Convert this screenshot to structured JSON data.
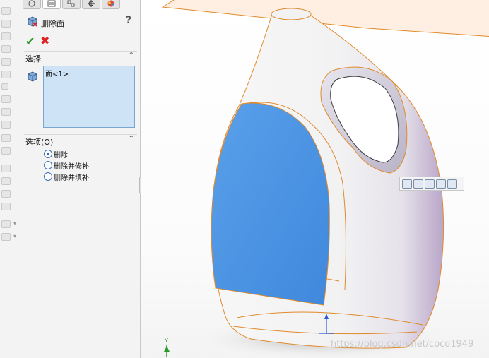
{
  "feature_manager": {
    "tabs": [
      "feature-tree-icon",
      "property-manager-icon",
      "configuration-icon",
      "dimxpert-icon",
      "display-manager-icon"
    ],
    "title": "删除面",
    "help": "?",
    "ok": "✔",
    "cancel": "✖"
  },
  "selection_section": {
    "label": "选择",
    "collapse": "⌃",
    "items": [
      "面<1>"
    ]
  },
  "options_section": {
    "label": "选项(O)",
    "collapse": "⌃",
    "options": [
      {
        "label": "删除",
        "checked": true
      },
      {
        "label": "删除并修补",
        "checked": false
      },
      {
        "label": "删除并填补",
        "checked": false
      }
    ]
  },
  "viewport": {
    "mini_toolbar": [
      "zoom-to-selection-icon",
      "normal-to-icon",
      "front-view-icon",
      "right-view-icon",
      "isometric-view-icon"
    ],
    "axis_label": "Y",
    "watermark": "https://blog.csdn.net/coco1949"
  },
  "colors": {
    "selected_face": "#4a90e2",
    "edge_highlight": "#e08a2a",
    "panel_bg": "#f3f3f3",
    "listbox_bg": "#cfe3f7"
  }
}
